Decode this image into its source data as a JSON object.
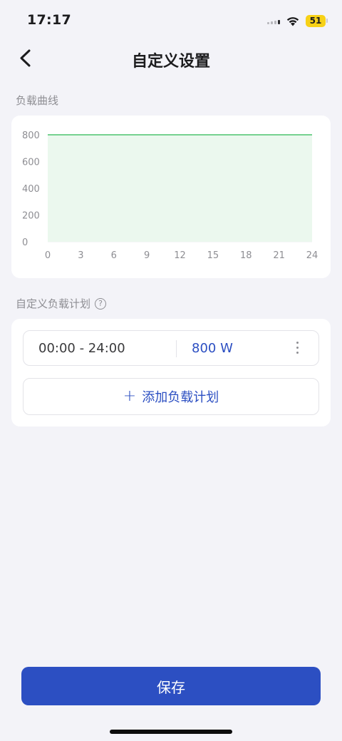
{
  "status_bar": {
    "time": "17:17",
    "battery": "51",
    "battery_color": "#f7d117"
  },
  "nav": {
    "title": "自定义设置",
    "back_icon": "chevron-left-icon"
  },
  "load_curve": {
    "label": "负载曲线"
  },
  "chart_data": {
    "type": "area",
    "x": [
      0,
      24
    ],
    "y": [
      800,
      800
    ],
    "xticks": [
      "0",
      "3",
      "6",
      "9",
      "12",
      "15",
      "18",
      "21",
      "24"
    ],
    "yticks": [
      "0",
      "200",
      "400",
      "600",
      "800"
    ],
    "xlim": [
      0,
      24
    ],
    "ylim": [
      0,
      800
    ],
    "grid": true,
    "line_color": "#4cc46e",
    "fill_color": "#ebf8ee"
  },
  "plan": {
    "label": "自定义负载计划",
    "help_icon": "question-circle-icon",
    "items": [
      {
        "time": "00:00 - 24:00",
        "power": "800 W"
      }
    ],
    "add_label": "添加负载计划",
    "add_icon": "plus-icon",
    "more_icon": "more-vertical-icon"
  },
  "save_label": "保存",
  "accent_color": "#2c4fc2"
}
